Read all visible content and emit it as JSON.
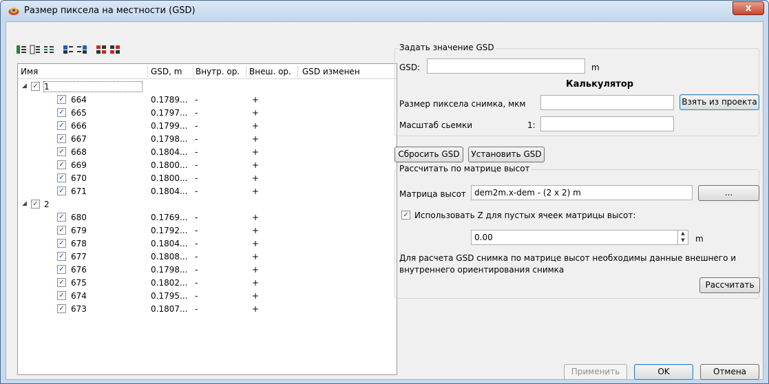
{
  "window": {
    "title": "Размер пиксела на местности (GSD)",
    "close_glyph": "x"
  },
  "toolbar": {
    "icons": [
      "expand-all-icon",
      "collapse-icon",
      "columns-icon",
      "check-all-icon",
      "uncheck-icon",
      "select-red-icon",
      "deselect-red-icon"
    ]
  },
  "tree": {
    "columns": [
      "Имя",
      "GSD, m",
      "Внутр. ор.",
      "Внеш. ор.",
      "GSD изменен"
    ],
    "groups": [
      {
        "name": "1",
        "checked": true,
        "rows": [
          {
            "name": "664",
            "gsd": "0.1789...",
            "inner": "-",
            "outer": "+"
          },
          {
            "name": "665",
            "gsd": "0.1797...",
            "inner": "-",
            "outer": "+"
          },
          {
            "name": "666",
            "gsd": "0.1799...",
            "inner": "-",
            "outer": "+"
          },
          {
            "name": "667",
            "gsd": "0.1798...",
            "inner": "-",
            "outer": "+"
          },
          {
            "name": "668",
            "gsd": "0.1804...",
            "inner": "-",
            "outer": "+"
          },
          {
            "name": "669",
            "gsd": "0.1800...",
            "inner": "-",
            "outer": "+"
          },
          {
            "name": "670",
            "gsd": "0.1800...",
            "inner": "-",
            "outer": "+"
          },
          {
            "name": "671",
            "gsd": "0.1804...",
            "inner": "-",
            "outer": "+"
          }
        ]
      },
      {
        "name": "2",
        "checked": true,
        "rows": [
          {
            "name": "680",
            "gsd": "0.1769...",
            "inner": "-",
            "outer": "+"
          },
          {
            "name": "679",
            "gsd": "0.1792...",
            "inner": "-",
            "outer": "+"
          },
          {
            "name": "678",
            "gsd": "0.1804...",
            "inner": "-",
            "outer": "+"
          },
          {
            "name": "677",
            "gsd": "0.1808...",
            "inner": "-",
            "outer": "+"
          },
          {
            "name": "676",
            "gsd": "0.1798...",
            "inner": "-",
            "outer": "+"
          },
          {
            "name": "675",
            "gsd": "0.1802...",
            "inner": "-",
            "outer": "+"
          },
          {
            "name": "674",
            "gsd": "0.1795...",
            "inner": "-",
            "outer": "+"
          },
          {
            "name": "673",
            "gsd": "0.1807...",
            "inner": "-",
            "outer": "+"
          }
        ]
      }
    ]
  },
  "set_gsd": {
    "group_title": "Задать значение GSD",
    "gsd_label": "GSD:",
    "gsd_value": "",
    "gsd_unit": "m",
    "calculator_title": "Калькулятор",
    "pixel_size_label": "Размер пиксела снимка, мкм",
    "pixel_size_value": "",
    "take_from_project_button": "Взять из проекта",
    "scale_label": "Масштаб сьемки",
    "scale_prefix": "1:",
    "scale_value": ""
  },
  "actions": {
    "reset_gsd": "Сбросить GSD",
    "set_gsd": "Установить GSD"
  },
  "dem": {
    "group_title": "Рассчитать по матрице высот",
    "matrix_label": "Матрица высот",
    "matrix_value": "dem2m.x-dem - (2 x 2) m",
    "browse_button": "...",
    "use_z_checked": true,
    "use_z_label": "Использовать Z для пустых ячеек матрицы высот:",
    "z_value": "0.00",
    "z_unit": "m",
    "note_line1": "Для расчета GSD снимка по матрице высот необходимы данные внешнего и",
    "note_line2": "внутреннего ориентирования снимка",
    "calculate_button": "Рассчитать"
  },
  "footer": {
    "apply": "Применить",
    "ok": "OK",
    "cancel": "Отмена"
  },
  "colors": {
    "title_bar": "#c7d9ee",
    "close_button": "#c8442d",
    "client_bg": "#f0f0f0"
  }
}
